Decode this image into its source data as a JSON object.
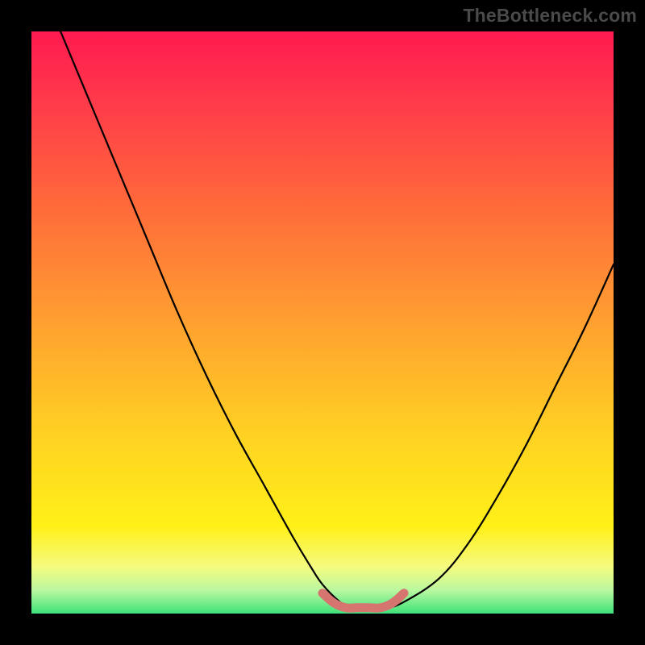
{
  "watermark": "TheBottleneck.com",
  "chart_data": {
    "type": "line",
    "title": "",
    "xlabel": "",
    "ylabel": "",
    "xlim": [
      0,
      100
    ],
    "ylim": [
      0,
      100
    ],
    "series": [
      {
        "name": "bottleneck-curve",
        "color": "#000000",
        "x": [
          5,
          10,
          15,
          20,
          25,
          30,
          35,
          40,
          45,
          48,
          50,
          53,
          55,
          58,
          61,
          64,
          70,
          75,
          80,
          85,
          90,
          95,
          100
        ],
        "y": [
          100,
          88,
          76,
          64,
          52,
          41,
          31,
          22,
          13,
          8,
          5,
          2,
          1,
          1,
          1,
          2,
          6,
          12,
          20,
          29,
          39,
          49,
          60
        ]
      },
      {
        "name": "highlight-band",
        "color": "#d6746f",
        "x": [
          50,
          52,
          54,
          56,
          58,
          60,
          62,
          64
        ],
        "y": [
          3.5,
          1.8,
          1,
          1,
          1,
          1,
          1.8,
          3.5
        ]
      }
    ]
  }
}
